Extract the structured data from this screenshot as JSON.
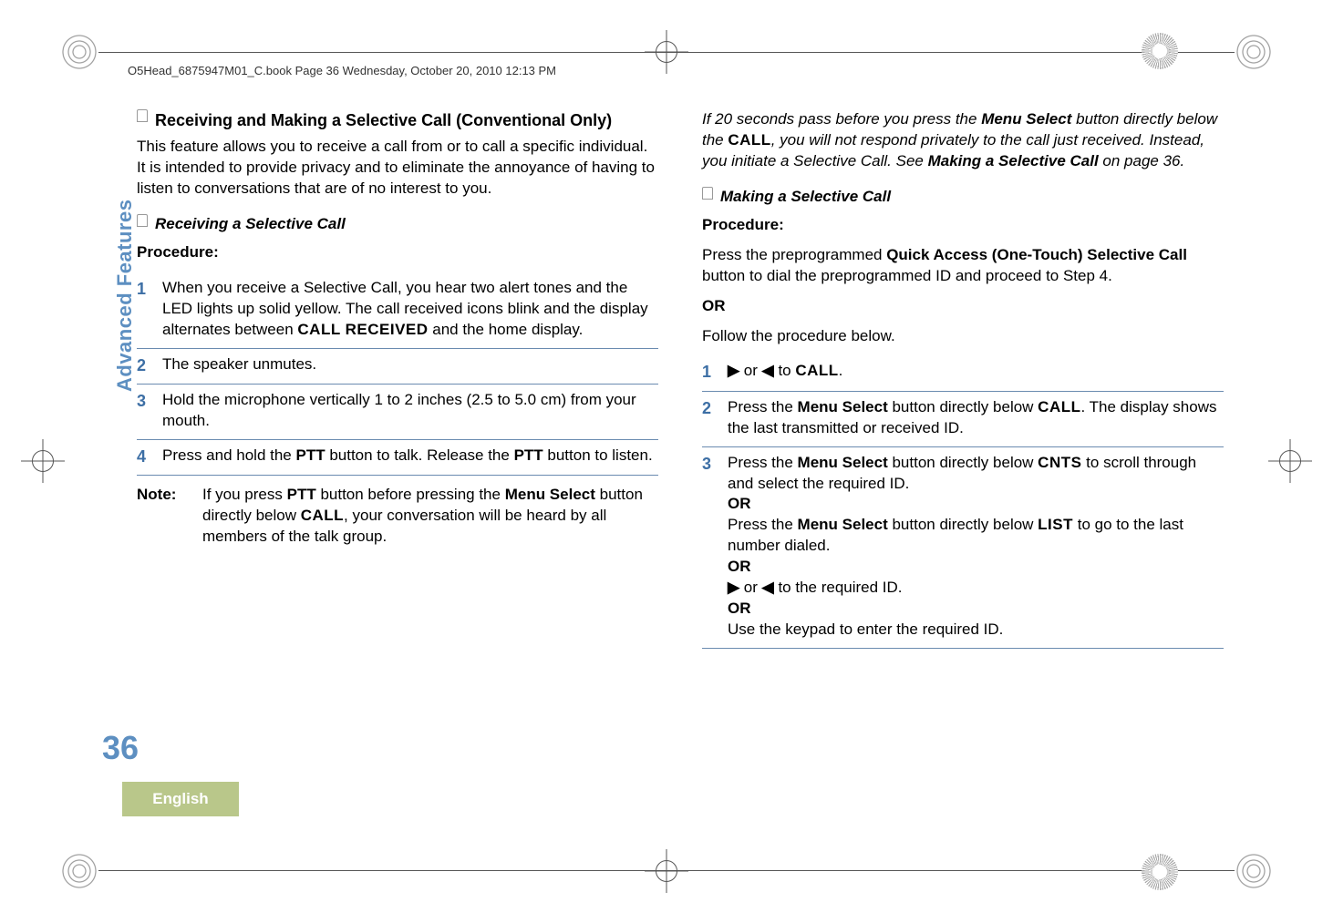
{
  "header": "O5Head_6875947M01_C.book  Page 36  Wednesday, October 20, 2010  12:13 PM",
  "sidebar_label": "Advanced Features",
  "page_number": "36",
  "language_tab": "English",
  "left": {
    "section_title": "Receiving and Making a Selective Call (Conventional Only)",
    "intro": "This feature allows you to receive a call from or to call a specific individual. It is intended to provide privacy and to eliminate the annoyance of having to listen to conversations that are of no interest to you.",
    "sub_title": "Receiving a Selective Call",
    "procedure_label": "Procedure:",
    "steps": [
      {
        "n": "1",
        "pre": "When you receive a Selective Call, you hear two alert tones and the LED lights up solid yellow. The call received icons blink and the display alternates between ",
        "mono": "CALL RECEIVED",
        "post": " and the home display."
      },
      {
        "n": "2",
        "pre": "The speaker unmutes.",
        "mono": "",
        "post": ""
      },
      {
        "n": "3",
        "pre": "Hold the microphone vertically 1 to 2 inches (2.5 to 5.0 cm) from your mouth.",
        "mono": "",
        "post": ""
      },
      {
        "n": "4",
        "pre": "Press and hold the ",
        "b1": "PTT",
        "mid": " button to talk. Release the ",
        "b2": "PTT",
        "post": " button to listen."
      }
    ],
    "note_label": "Note:",
    "note_pre": "If you press ",
    "note_b1": "PTT",
    "note_mid1": " button before pressing the ",
    "note_b2": "Menu Select",
    "note_mid2": " button directly below ",
    "note_mono": "CALL",
    "note_post": ", your conversation will be heard by all members of the talk group."
  },
  "right": {
    "intro_pre": "If 20 seconds pass before you press the ",
    "intro_b1": "Menu Select",
    "intro_mid1": " button directly below the ",
    "intro_mono": "CALL",
    "intro_mid2": ", you will not respond privately to the call just received. Instead, you initiate a Selective Call. See ",
    "intro_b2": "Making a Selective Call",
    "intro_post": " on page 36.",
    "sub_title": "Making a Selective Call",
    "procedure_label": "Procedure:",
    "proc_pre": "Press the preprogrammed ",
    "proc_b": "Quick Access (One-Touch) Selective Call",
    "proc_post": " button to dial the preprogrammed ID and proceed to Step 4.",
    "or": "OR",
    "follow": "Follow the procedure below.",
    "step1_n": "1",
    "step1_mid": " or ",
    "step1_to": " to ",
    "step1_mono": "CALL",
    "step1_dot": ".",
    "step2_n": "2",
    "step2_pre": "Press the ",
    "step2_b": "Menu Select",
    "step2_mid": " button directly below ",
    "step2_mono": "CALL",
    "step2_post": ". The display shows the last transmitted or received ID.",
    "step3_n": "3",
    "step3_pre": "Press the ",
    "step3_b": "Menu Select",
    "step3_mid": " button directly below ",
    "step3_mono1": "CNTS",
    "step3_post1": " to scroll through and select the required ID.",
    "step3_or1": "OR",
    "step3_pre2": "Press the ",
    "step3_b2": "Menu Select",
    "step3_mid2": " button directly below ",
    "step3_mono2": "LIST",
    "step3_post2": " to go to the last number dialed.",
    "step3_or2": "OR",
    "step3_arrow_mid": " or ",
    "step3_arrow_post": " to the required ID.",
    "step3_or3": "OR",
    "step3_keypad": "Use the keypad to enter the required ID."
  }
}
